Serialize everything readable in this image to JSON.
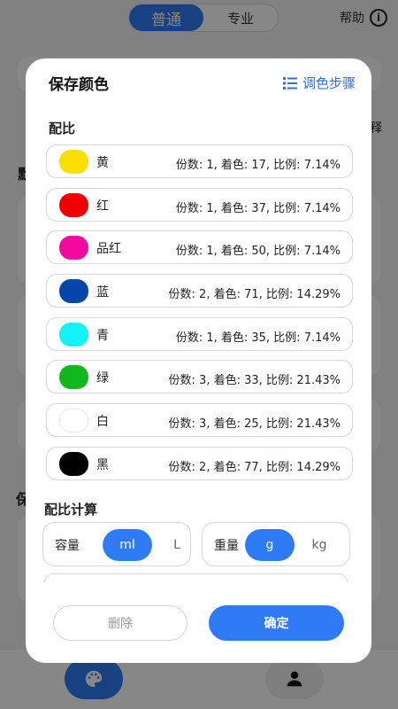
{
  "topbar": {
    "modes": [
      "普通",
      "专业"
    ],
    "help_label": "帮助",
    "help_icon": "i"
  },
  "background": {
    "partial_text_1": "默",
    "partial_text_2": "保",
    "partial_text_3": "释"
  },
  "modal": {
    "title": "保存颜色",
    "steps_label": "调色步骤",
    "ratio_section": "配比",
    "colors": [
      {
        "name": "黄",
        "info": "份数: 1, 着色: 17, 比例: 7.14%",
        "swatch": "#f9e000"
      },
      {
        "name": "红",
        "info": "份数: 1, 着色: 37, 比例: 7.14%",
        "swatch": "#f00000"
      },
      {
        "name": "品红",
        "info": "份数: 1, 着色: 50, 比例: 7.14%",
        "swatch": "#f20aa0"
      },
      {
        "name": "蓝",
        "info": "份数: 2, 着色: 71, 比例: 14.29%",
        "swatch": "#0646a9"
      },
      {
        "name": "青",
        "info": "份数: 1, 着色: 35, 比例: 7.14%",
        "swatch": "#11f3f7"
      },
      {
        "name": "绿",
        "info": "份数: 3, 着色: 33, 比例: 21.43%",
        "swatch": "#10b81c"
      },
      {
        "name": "白",
        "info": "份数: 3, 着色: 25, 比例: 21.43%",
        "swatch": "#ffffff"
      },
      {
        "name": "黑",
        "info": "份数: 2, 着色: 77, 比例: 14.29%",
        "swatch": "#000000"
      }
    ],
    "calc_section": "配比计算",
    "volume": {
      "label": "容量",
      "options": [
        "ml",
        "L"
      ],
      "selected": "ml"
    },
    "weight": {
      "label": "重量",
      "options": [
        "g",
        "kg"
      ],
      "selected": "g"
    },
    "delete_label": "删除",
    "confirm_label": "确定"
  },
  "accent_color": "#2f7bf6"
}
